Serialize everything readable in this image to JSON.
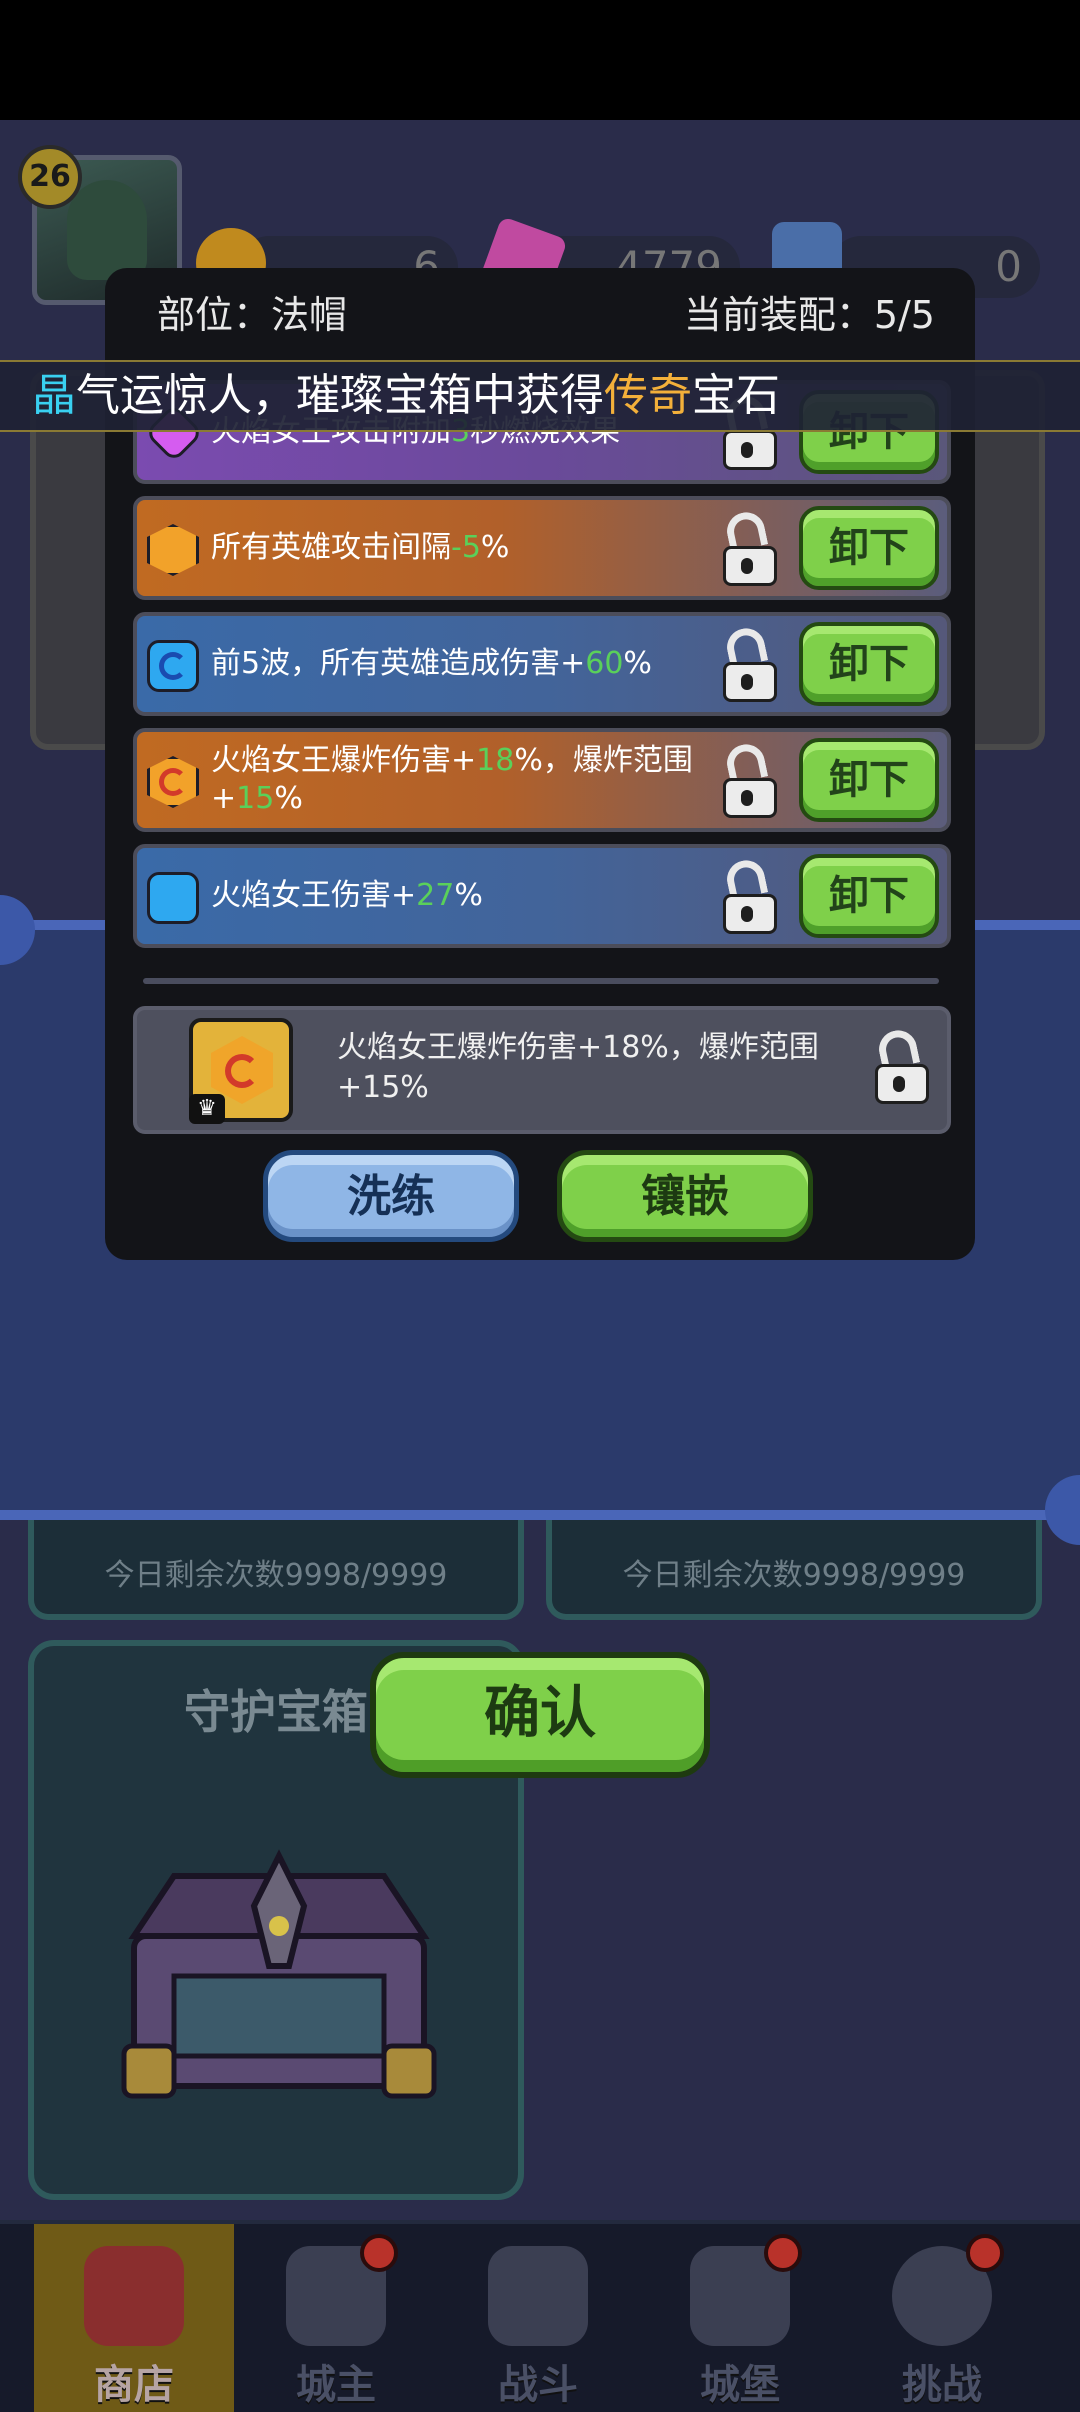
{
  "player": {
    "level": "26"
  },
  "resources": [
    {
      "name": "coin",
      "value": "6"
    },
    {
      "name": "gem",
      "value": "4779"
    },
    {
      "name": "medal",
      "value": "0"
    }
  ],
  "marquee": {
    "prefix": "晶",
    "mid": "气运惊人，璀璨宝箱中获得",
    "highlight": "传奇",
    "suffix": "宝石"
  },
  "modal": {
    "part_label": "部位：法帽",
    "equip_count": "当前装配：5/5",
    "rows": [
      {
        "gem": "purple",
        "text_a": "火焰女王攻击附加",
        "hl": "3",
        "text_b": "秒燃烧效果",
        "button": "卸下"
      },
      {
        "gem": "orange",
        "text_a": "所有英雄攻击间隔",
        "hl": "-5",
        "text_b": "%",
        "button": "卸下"
      },
      {
        "gem": "blue",
        "text_a": "前5波，所有英雄造成伤害+",
        "hl": "60",
        "text_b": "%",
        "button": "卸下"
      },
      {
        "gem": "orange",
        "text_a": "火焰女王爆炸伤害+",
        "hl": "18",
        "text_b": "%，爆炸范围+",
        "hl2": "15",
        "text_c": "%",
        "button": "卸下"
      },
      {
        "gem": "blue",
        "text_a": "火焰女王伤害+",
        "hl": "27",
        "text_b": "%",
        "button": "卸下"
      }
    ],
    "preview": {
      "text": "火焰女王爆炸伤害+18%，爆炸范围+15%"
    },
    "wash_button": "洗练",
    "inlay_button": "镶嵌"
  },
  "confirm_button": "确认",
  "background": {
    "remaining_left": "今日剩余次数9998/9999",
    "remaining_right": "今日剩余次数9998/9999",
    "chest_title": "守护宝箱"
  },
  "nav": [
    {
      "label": "商店",
      "active": true
    },
    {
      "label": "城主",
      "badge": true
    },
    {
      "label": "战斗"
    },
    {
      "label": "城堡",
      "badge": true
    },
    {
      "label": "挑战",
      "badge": true
    }
  ],
  "colors": {
    "accent_green": "#7fd04a",
    "highlight_green": "#5ad05a",
    "legend_gold": "#f3b03a",
    "cyan": "#39d0f0"
  }
}
